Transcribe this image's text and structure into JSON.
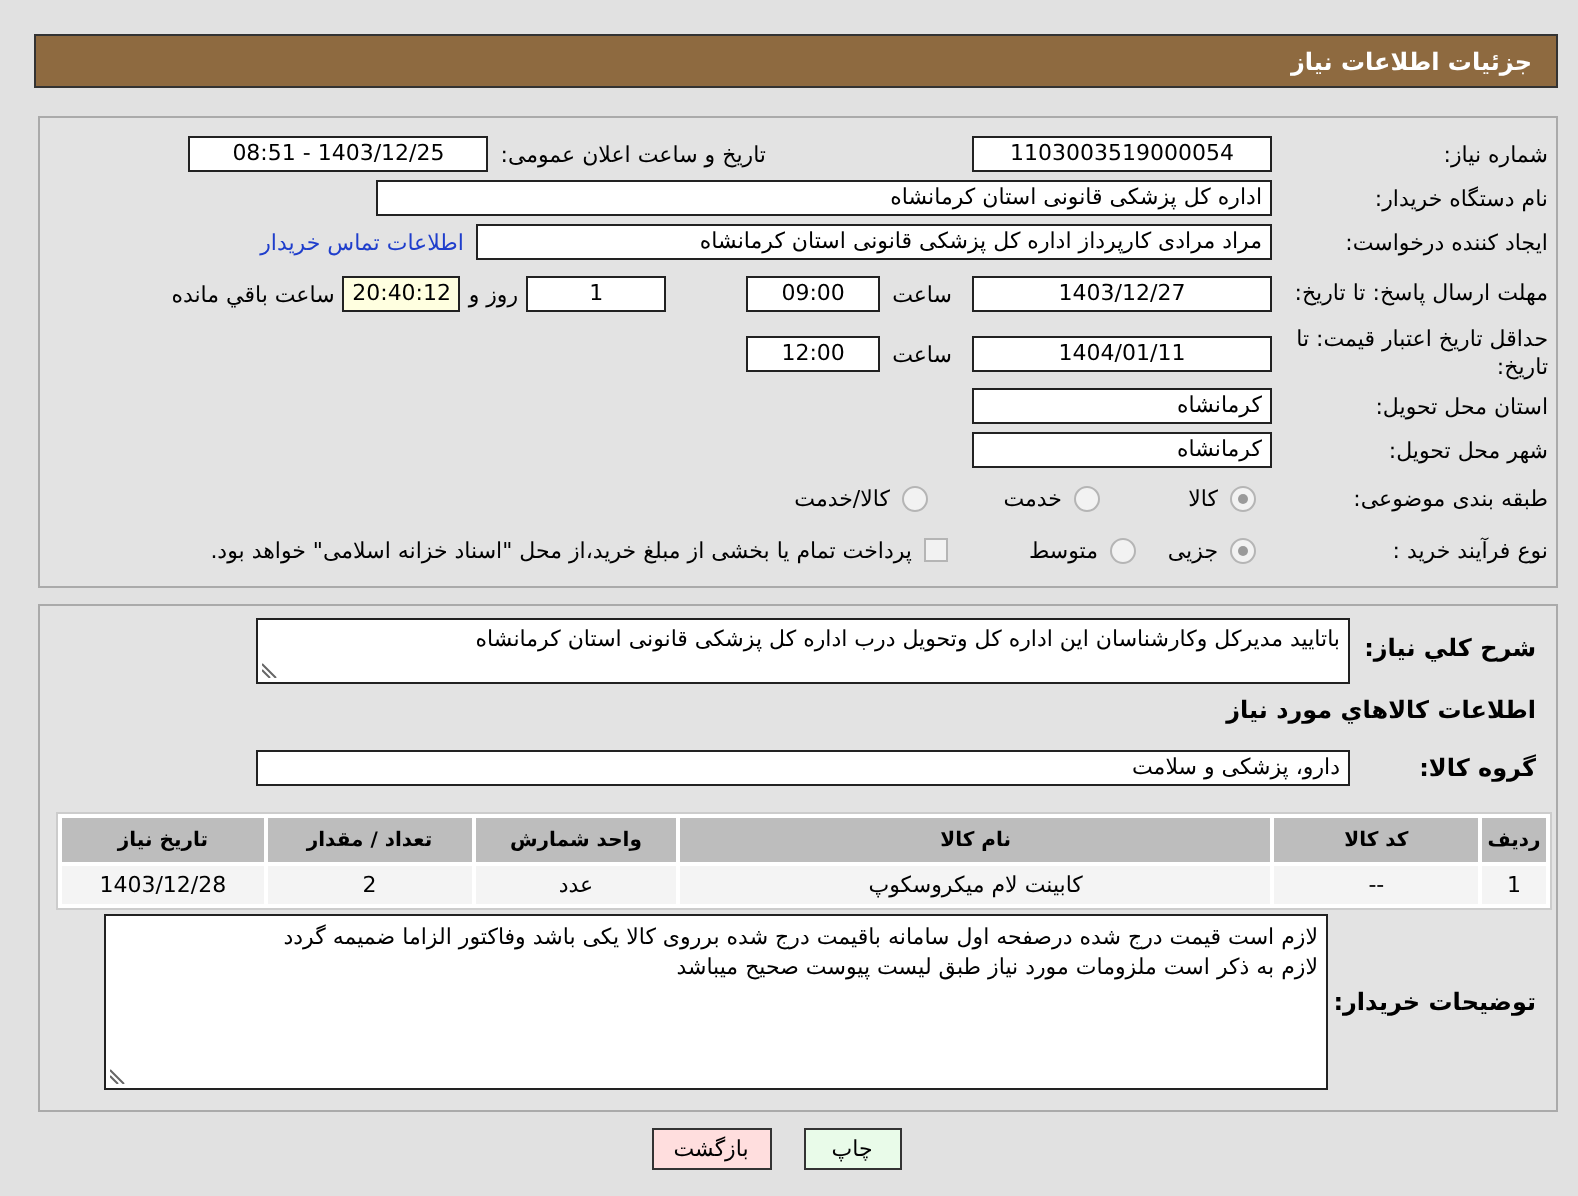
{
  "header": {
    "title": "جزئیات اطلاعات نیاز"
  },
  "need_number": {
    "label": "شماره نیاز:",
    "value": "1103003519000054"
  },
  "announce": {
    "label": "تاریخ و ساعت اعلان عمومی:",
    "value": "1403/12/25 - 08:51"
  },
  "buyer_org": {
    "label": "نام دستگاه خریدار:",
    "value": "اداره کل پزشکی قانونی استان کرمانشاه"
  },
  "requester": {
    "label": "ایجاد کننده درخواست:",
    "value": "مراد مرادی کارپرداز اداره کل پزشکی قانونی استان کرمانشاه",
    "link": "اطلاعات تماس خریدار"
  },
  "reply_deadline": {
    "label": "مهلت ارسال پاسخ: تا تاریخ:",
    "date": "1403/12/27",
    "time_label": "ساعت",
    "time": "09:00",
    "days": "1",
    "days_label": "روز و",
    "remaining": "20:40:12",
    "remaining_label": "ساعت باقي مانده"
  },
  "price_validity": {
    "label": "حداقل تاریخ اعتبار قیمت: تا تاریخ:",
    "date": "1404/01/11",
    "time_label": "ساعت",
    "time": "12:00"
  },
  "province": {
    "label": "استان محل تحویل:",
    "value": "کرمانشاه"
  },
  "city": {
    "label": "شهر محل تحویل:",
    "value": "کرمانشاه"
  },
  "category": {
    "label": "طبقه بندی موضوعی:",
    "options": [
      {
        "label": "کالا",
        "selected": true
      },
      {
        "label": "خدمت",
        "selected": false
      },
      {
        "label": "کالا/خدمت",
        "selected": false
      }
    ]
  },
  "purchase_type": {
    "label": "نوع فرآیند خرید :",
    "options": [
      {
        "label": "جزیی",
        "selected": true
      },
      {
        "label": "متوسط",
        "selected": false
      }
    ],
    "payment": {
      "label": "پرداخت تمام یا بخشی از مبلغ خرید،از محل \"اسناد خزانه اسلامی\" خواهد بود.",
      "checked": false
    }
  },
  "description": {
    "label": "شرح کلي نياز:",
    "value": "باتایید مدیرکل وکارشناسان این اداره کل وتحویل درب اداره کل پزشکی قانونی استان کرمانشاه"
  },
  "goods_heading": "اطلاعات کالاهاي مورد نياز",
  "goods_group": {
    "label": "گروه کالا:",
    "value": "دارو، پزشکی و سلامت"
  },
  "table": {
    "columns": [
      "ردیف",
      "کد کالا",
      "نام کالا",
      "واحد شمارش",
      "تعداد / مقدار",
      "تاریخ نیاز"
    ],
    "rows": [
      [
        "1",
        "--",
        "کابینت لام میکروسکوپ",
        "عدد",
        "2",
        "1403/12/28"
      ]
    ]
  },
  "buyer_notes": {
    "label": "توضیحات خریدار:",
    "lines": [
      "لازم است قیمت درج شده درصفحه اول سامانه باقیمت درج شده برروی کالا یکی باشد وفاکتور الزاما ضمیمه گردد",
      "لازم به ذکر است ملزومات مورد نیاز طبق لیست پیوست صحیح میباشد"
    ]
  },
  "buttons": [
    {
      "label": "چاپ",
      "kind": "print"
    },
    {
      "label": "بازگشت",
      "kind": "back"
    }
  ]
}
